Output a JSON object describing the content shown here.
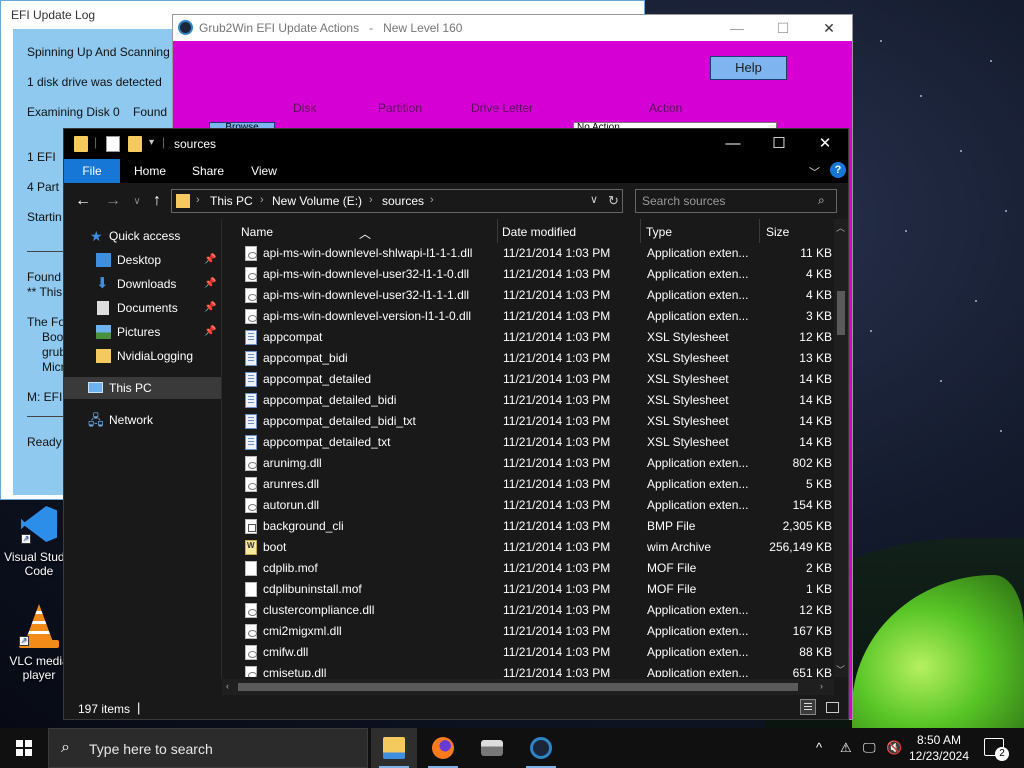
{
  "efi_log": {
    "title": "EFI Update Log",
    "lines": [
      "Spinning Up And Scanning",
      "1 disk drive was detected",
      "Examining Disk 0    Found",
      "1  EFI",
      "4  Part",
      "Startin",
      "Found",
      "** This",
      "The Fo",
      "Boo",
      "grub",
      "Micr",
      "M: EFI",
      "Ready"
    ]
  },
  "grub2win": {
    "title": "Grub2Win EFI Update Actions   -   New Level 160",
    "help_label": "Help",
    "columns": [
      "Disk",
      "Partition",
      "Drive Letter",
      "Action"
    ],
    "browse_label": "Browse",
    "action_value": "No Action"
  },
  "explorer": {
    "title": "sources",
    "ribbon_tabs": [
      "File",
      "Home",
      "Share",
      "View"
    ],
    "address": {
      "crumbs": [
        "This PC",
        "New Volume (E:)",
        "sources"
      ]
    },
    "search_placeholder": "Search sources",
    "nav": {
      "quick_access": "Quick access",
      "items": [
        "Desktop",
        "Downloads",
        "Documents",
        "Pictures",
        "NvidiaLogging"
      ],
      "this_pc": "This PC",
      "network": "Network"
    },
    "columns": {
      "name": "Name",
      "date": "Date modified",
      "type": "Type",
      "size": "Size"
    },
    "files": [
      {
        "name": "api-ms-win-downlevel-shlwapi-l1-1-1.dll",
        "date": "11/21/2014 1:03 PM",
        "type": "Application exten...",
        "size": "11 KB",
        "icon": "dll"
      },
      {
        "name": "api-ms-win-downlevel-user32-l1-1-0.dll",
        "date": "11/21/2014 1:03 PM",
        "type": "Application exten...",
        "size": "4 KB",
        "icon": "dll"
      },
      {
        "name": "api-ms-win-downlevel-user32-l1-1-1.dll",
        "date": "11/21/2014 1:03 PM",
        "type": "Application exten...",
        "size": "4 KB",
        "icon": "dll"
      },
      {
        "name": "api-ms-win-downlevel-version-l1-1-0.dll",
        "date": "11/21/2014 1:03 PM",
        "type": "Application exten...",
        "size": "3 KB",
        "icon": "dll"
      },
      {
        "name": "appcompat",
        "date": "11/21/2014 1:03 PM",
        "type": "XSL Stylesheet",
        "size": "12 KB",
        "icon": "xsl"
      },
      {
        "name": "appcompat_bidi",
        "date": "11/21/2014 1:03 PM",
        "type": "XSL Stylesheet",
        "size": "13 KB",
        "icon": "xsl"
      },
      {
        "name": "appcompat_detailed",
        "date": "11/21/2014 1:03 PM",
        "type": "XSL Stylesheet",
        "size": "14 KB",
        "icon": "xsl"
      },
      {
        "name": "appcompat_detailed_bidi",
        "date": "11/21/2014 1:03 PM",
        "type": "XSL Stylesheet",
        "size": "14 KB",
        "icon": "xsl"
      },
      {
        "name": "appcompat_detailed_bidi_txt",
        "date": "11/21/2014 1:03 PM",
        "type": "XSL Stylesheet",
        "size": "14 KB",
        "icon": "xsl"
      },
      {
        "name": "appcompat_detailed_txt",
        "date": "11/21/2014 1:03 PM",
        "type": "XSL Stylesheet",
        "size": "14 KB",
        "icon": "xsl"
      },
      {
        "name": "arunimg.dll",
        "date": "11/21/2014 1:03 PM",
        "type": "Application exten...",
        "size": "802 KB",
        "icon": "dll"
      },
      {
        "name": "arunres.dll",
        "date": "11/21/2014 1:03 PM",
        "type": "Application exten...",
        "size": "5 KB",
        "icon": "dll"
      },
      {
        "name": "autorun.dll",
        "date": "11/21/2014 1:03 PM",
        "type": "Application exten...",
        "size": "154 KB",
        "icon": "dll"
      },
      {
        "name": "background_cli",
        "date": "11/21/2014 1:03 PM",
        "type": "BMP File",
        "size": "2,305 KB",
        "icon": "bmp"
      },
      {
        "name": "boot",
        "date": "11/21/2014 1:03 PM",
        "type": "wim Archive",
        "size": "256,149 KB",
        "icon": "wim"
      },
      {
        "name": "cdplib.mof",
        "date": "11/21/2014 1:03 PM",
        "type": "MOF File",
        "size": "2 KB",
        "icon": "mof"
      },
      {
        "name": "cdplibuninstall.mof",
        "date": "11/21/2014 1:03 PM",
        "type": "MOF File",
        "size": "1 KB",
        "icon": "mof"
      },
      {
        "name": "clustercompliance.dll",
        "date": "11/21/2014 1:03 PM",
        "type": "Application exten...",
        "size": "12 KB",
        "icon": "dll"
      },
      {
        "name": "cmi2migxml.dll",
        "date": "11/21/2014 1:03 PM",
        "type": "Application exten...",
        "size": "167 KB",
        "icon": "dll"
      },
      {
        "name": "cmifw.dll",
        "date": "11/21/2014 1:03 PM",
        "type": "Application exten...",
        "size": "88 KB",
        "icon": "dll"
      },
      {
        "name": "cmisetup.dll",
        "date": "11/21/2014 1:03 PM",
        "type": "Application exten...",
        "size": "651 KB",
        "icon": "dll"
      }
    ],
    "status_count": "197 items"
  },
  "desktop_icons": [
    {
      "label": "Visual Studio Code",
      "icon": "vscode-icon"
    },
    {
      "label": "VLC media player",
      "icon": "vlc-icon"
    }
  ],
  "taskbar": {
    "search_placeholder": "Type here to search",
    "apps": [
      "file-explorer-icon",
      "firefox-icon",
      "drive-app-icon",
      "grub2win-icon"
    ],
    "time": "8:50 AM",
    "date": "12/23/2024",
    "notification_count": "2"
  },
  "colors": {
    "grub_bg": "#d400d4",
    "log_bg": "#8fc9ef",
    "accent": "#1677d6",
    "explorer_bg": "#191919"
  }
}
